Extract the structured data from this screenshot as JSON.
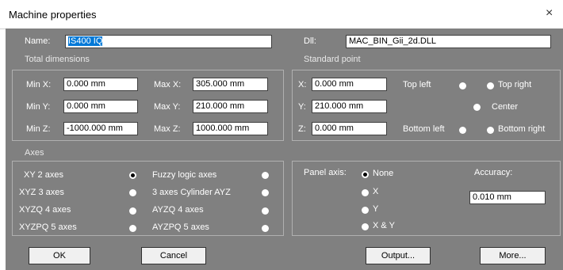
{
  "window": {
    "title": "Machine properties",
    "close_glyph": "×"
  },
  "name": {
    "label": "Name:",
    "value": "IS400 IQ"
  },
  "dll": {
    "label": "Dll:",
    "value": "MAC_BIN_Gii_2d.DLL"
  },
  "total_dimensions": {
    "title": "Total dimensions",
    "min_x": {
      "label": "Min X:",
      "value": "0.000 mm"
    },
    "min_y": {
      "label": "Min Y:",
      "value": "0.000 mm"
    },
    "min_z": {
      "label": "Min Z:",
      "value": "-1000.000 mm"
    },
    "max_x": {
      "label": "Max X:",
      "value": "305.000 mm"
    },
    "max_y": {
      "label": "Max Y:",
      "value": "210.000 mm"
    },
    "max_z": {
      "label": "Max Z:",
      "value": "1000.000 mm"
    }
  },
  "standard_point": {
    "title": "Standard point",
    "x": {
      "label": "X:",
      "value": "0.000 mm"
    },
    "y": {
      "label": "Y:",
      "value": "210.000 mm"
    },
    "z": {
      "label": "Z:",
      "value": "0.000 mm"
    },
    "top_left": "Top left",
    "top_right": "Top right",
    "center": "Center",
    "bottom_left": "Bottom left",
    "bottom_right": "Bottom right",
    "selected": "Top left"
  },
  "axes": {
    "title": "Axes",
    "options": [
      "XY 2 axes",
      "XYZ 3 axes",
      "XYZQ 4 axes",
      "XYZPQ 5 axes",
      "Fuzzy logic axes",
      "3 axes Cylinder AYZ",
      "AYZQ 4 axes",
      "AYZPQ 5 axes"
    ],
    "selected": "XY 2 axes"
  },
  "panel_axis": {
    "label": "Panel axis:",
    "options": [
      "None",
      "X",
      "Y",
      "X & Y"
    ],
    "selected": "None"
  },
  "accuracy": {
    "label": "Accuracy:",
    "value": "0.010 mm"
  },
  "buttons": {
    "ok": "OK",
    "cancel": "Cancel",
    "output": "Output...",
    "more": "More..."
  }
}
